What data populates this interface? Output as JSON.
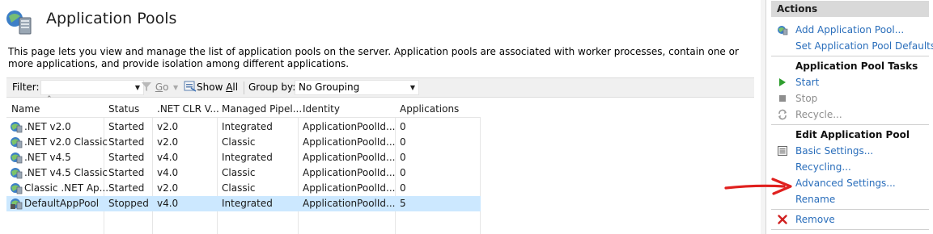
{
  "header": {
    "title": "Application Pools",
    "description": "This page lets you view and manage the list of application pools on the server. Application pools are associated with worker processes, contain one or more applications, and provide isolation among different applications."
  },
  "filter_bar": {
    "filter_label": "Filter:",
    "filter_value": "",
    "go_label_prefix": "",
    "go_label_u": "G",
    "go_label_rest": "o",
    "showall_prefix": "Show ",
    "showall_u": "A",
    "showall_rest": "ll",
    "groupby_label": "Group by:",
    "groupby_value": "No Grouping"
  },
  "table": {
    "columns": [
      "Name",
      "Status",
      ".NET CLR V...",
      "Managed Pipel...",
      "Identity",
      "Applications"
    ],
    "rows": [
      {
        "name": ".NET v2.0",
        "status": "Started",
        "clr": "v2.0",
        "pipeline": "Integrated",
        "identity": "ApplicationPoolId...",
        "apps": "0"
      },
      {
        "name": ".NET v2.0 Classic",
        "status": "Started",
        "clr": "v2.0",
        "pipeline": "Classic",
        "identity": "ApplicationPoolId...",
        "apps": "0"
      },
      {
        "name": ".NET v4.5",
        "status": "Started",
        "clr": "v4.0",
        "pipeline": "Integrated",
        "identity": "ApplicationPoolId...",
        "apps": "0"
      },
      {
        "name": ".NET v4.5 Classic",
        "status": "Started",
        "clr": "v4.0",
        "pipeline": "Classic",
        "identity": "ApplicationPoolId...",
        "apps": "0"
      },
      {
        "name": "Classic .NET Ap...",
        "status": "Started",
        "clr": "v2.0",
        "pipeline": "Classic",
        "identity": "ApplicationPoolId...",
        "apps": "0"
      },
      {
        "name": "DefaultAppPool",
        "status": "Stopped",
        "clr": "v4.0",
        "pipeline": "Integrated",
        "identity": "ApplicationPoolId...",
        "apps": "5"
      }
    ],
    "selected_row": "DefaultAppPool"
  },
  "actions": {
    "header": "Actions",
    "add_pool": "Add Application Pool...",
    "set_defaults": "Set Application Pool Defaults...",
    "tasks_header": "Application Pool Tasks",
    "start": "Start",
    "stop": "Stop",
    "recycle": "Recycle...",
    "edit_header": "Edit Application Pool",
    "basic_settings": "Basic Settings...",
    "recycling": "Recycling...",
    "advanced_settings": "Advanced Settings...",
    "rename": "Rename",
    "remove": "Remove"
  },
  "colors": {
    "link": "#2a6ebb",
    "selection": "#cce8ff",
    "annotation_arrow": "#e0201e",
    "start_icon": "#2e9e2e",
    "remove_icon": "#d02020"
  },
  "icons": [
    "application-pools-icon",
    "dropdown-icon",
    "filter-go-icon",
    "show-all-icon",
    "app-pool-icon",
    "add-pool-icon",
    "start-icon",
    "stop-icon",
    "recycle-icon",
    "basic-settings-icon",
    "remove-icon",
    "annotation-arrow"
  ]
}
